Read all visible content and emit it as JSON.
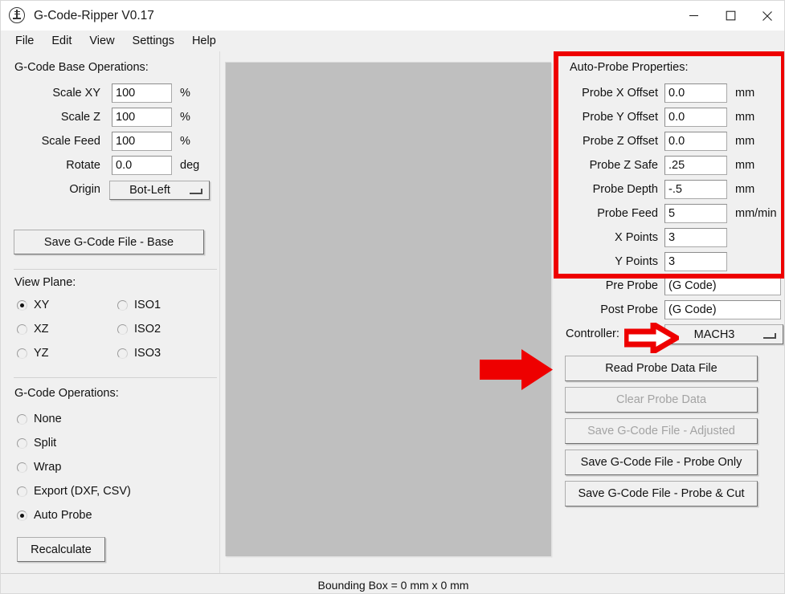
{
  "window": {
    "title": "G-Code-Ripper V0.17",
    "icon": "gcode-ripper-logo-icon",
    "controls": {
      "minimize": "minimize-icon",
      "maximize": "maximize-icon",
      "close": "close-icon"
    }
  },
  "menu": {
    "items": [
      "File",
      "Edit",
      "View",
      "Settings",
      "Help"
    ]
  },
  "left_panel": {
    "base_operations": {
      "title": "G-Code Base Operations:",
      "rows": [
        {
          "label": "Scale XY",
          "value": "100",
          "unit": "%"
        },
        {
          "label": "Scale Z",
          "value": "100",
          "unit": "%"
        },
        {
          "label": "Scale Feed",
          "value": "100",
          "unit": "%"
        },
        {
          "label": "Rotate",
          "value": "0.0",
          "unit": "deg"
        }
      ],
      "origin": {
        "label": "Origin",
        "value": "Bot-Left"
      },
      "save_base_button": "Save G-Code File - Base"
    },
    "view_plane": {
      "title": "View Plane:",
      "options": [
        {
          "label": "XY",
          "checked": true
        },
        {
          "label": "ISO1",
          "checked": false
        },
        {
          "label": "XZ",
          "checked": false
        },
        {
          "label": "ISO2",
          "checked": false
        },
        {
          "label": "YZ",
          "checked": false
        },
        {
          "label": "ISO3",
          "checked": false
        }
      ]
    },
    "gcode_operations": {
      "title": "G-Code Operations:",
      "options": [
        {
          "label": "None",
          "checked": false
        },
        {
          "label": "Split",
          "checked": false
        },
        {
          "label": "Wrap",
          "checked": false
        },
        {
          "label": "Export (DXF, CSV)",
          "checked": false
        },
        {
          "label": "Auto Probe",
          "checked": true
        }
      ],
      "recalculate_button": "Recalculate"
    }
  },
  "right_panel": {
    "title": "Auto-Probe Properties:",
    "rows": [
      {
        "label": "Probe X Offset",
        "value": "0.0",
        "unit": "mm"
      },
      {
        "label": "Probe Y Offset",
        "value": "0.0",
        "unit": "mm"
      },
      {
        "label": "Probe Z Offset",
        "value": "0.0",
        "unit": "mm"
      },
      {
        "label": "Probe Z Safe",
        "value": ".25",
        "unit": "mm"
      },
      {
        "label": "Probe Depth",
        "value": "-.5",
        "unit": "mm"
      },
      {
        "label": "Probe Feed",
        "value": "5",
        "unit": "mm/min"
      },
      {
        "label": "X Points",
        "value": "3",
        "unit": ""
      },
      {
        "label": "Y Points",
        "value": "3",
        "unit": ""
      }
    ],
    "pre_probe": {
      "label": "Pre Probe",
      "value": "(G Code)"
    },
    "post_probe": {
      "label": "Post Probe",
      "value": "(G Code)"
    },
    "controller": {
      "label": "Controller:",
      "value": "MACH3"
    },
    "buttons": [
      {
        "label": "Read Probe Data File",
        "disabled": false
      },
      {
        "label": "Clear Probe Data",
        "disabled": true
      },
      {
        "label": "Save G-Code File - Adjusted",
        "disabled": true
      },
      {
        "label": "Save G-Code File - Probe Only",
        "disabled": false
      },
      {
        "label": "Save G-Code File - Probe & Cut",
        "disabled": false
      }
    ]
  },
  "status_bar": {
    "text": "Bounding Box = 0 mm  x 0 mm"
  },
  "annotations": {
    "highlight_color": "#ee0000",
    "highlight_target": "auto-probe-properties-group",
    "arrow_solid_target": "read-probe-data-file-button",
    "arrow_hollow_target": "controller-dropdown"
  }
}
